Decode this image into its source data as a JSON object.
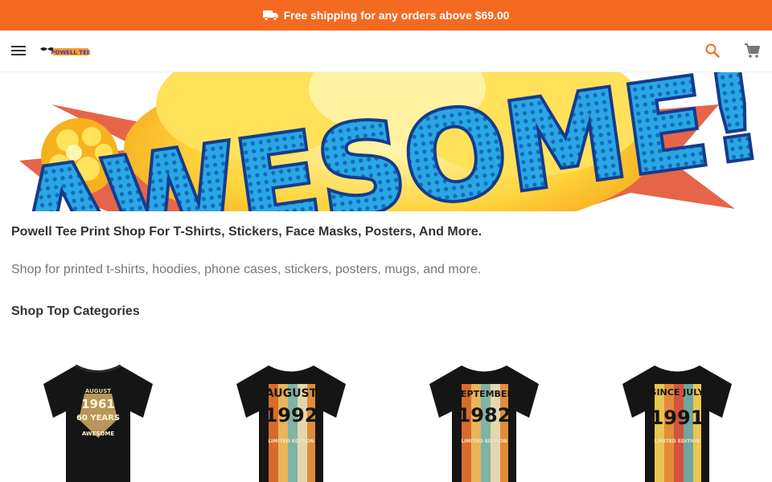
{
  "promo": {
    "text": "Free shipping for any orders above $69.00",
    "icon": "truck-icon",
    "color": "#f46a20"
  },
  "header": {
    "menu_icon": "menu-icon",
    "logo_text": "POWELL TEE",
    "search_icon": "search-icon",
    "cart_icon": "cart-icon"
  },
  "hero": {
    "banner_text": "AWESOME!"
  },
  "main": {
    "headline": "Powell Tee Print Shop For T-Shirts, Stickers, Face Masks, Posters, And More.",
    "description": "Shop for printed t-shirts, hoodies, phone cases, stickers, posters, mugs, and more.",
    "section_title": "Shop Top Categories"
  },
  "products": [
    {
      "line1": "AUGUST",
      "line2": "1961",
      "line3": "60 YEARS",
      "line4": "AWESOME"
    },
    {
      "line1": "AUGUST",
      "line2": "1992",
      "line3": "LIMITED EDITION"
    },
    {
      "line1": "SEPTEMBER",
      "line2": "1982",
      "line3": "LIMITED EDITION"
    },
    {
      "line1": "SINCE JULY",
      "line2": "1991",
      "line3": "LIMITED EDITION"
    }
  ]
}
